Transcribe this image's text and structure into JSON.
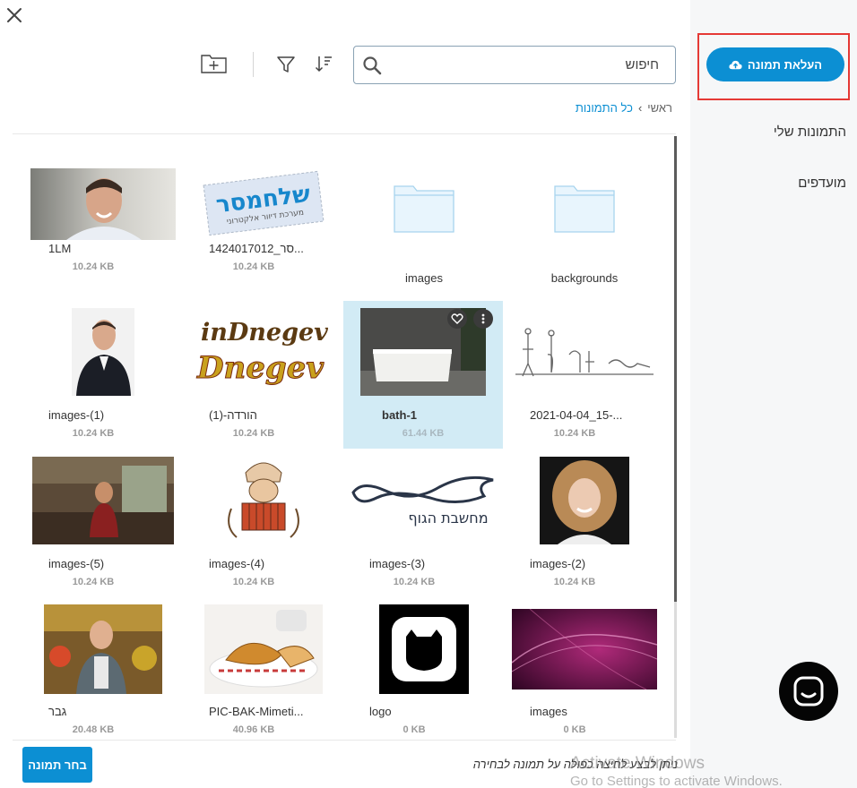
{
  "sidebar": {
    "upload_label": "העלאת תמונה",
    "items": [
      {
        "label": "התמונות שלי"
      },
      {
        "label": "מועדפים"
      }
    ]
  },
  "toolbar": {
    "search_placeholder": "חיפוש"
  },
  "breadcrumb": {
    "root": "ראשי",
    "separator": "›",
    "current": "כל התמונות"
  },
  "files": [
    {
      "name": "1LM",
      "size": "10.24 KB",
      "kind": "image",
      "icon": "portrait-man-smiling"
    },
    {
      "name": "1424017012_סר...",
      "size": "10.24 KB",
      "kind": "image",
      "icon": "shelachmeser-logo"
    },
    {
      "name": "images",
      "kind": "folder",
      "icon": "folder-icon"
    },
    {
      "name": "backgrounds",
      "kind": "folder",
      "icon": "folder-icon"
    },
    {
      "name": "images-(1)",
      "size": "10.24 KB",
      "kind": "image",
      "icon": "portrait-man-suit"
    },
    {
      "name": "הורדה-(1)",
      "size": "10.24 KB",
      "kind": "image",
      "icon": "indnegev-logo"
    },
    {
      "name": "bath-1",
      "size": "61.44 KB",
      "kind": "image",
      "selected": true,
      "icon": "bathtub-photo"
    },
    {
      "name": "2021-04-04_15-...",
      "size": "10.24 KB",
      "kind": "image",
      "icon": "sketch-figures"
    },
    {
      "name": "images-(5)",
      "size": "10.24 KB",
      "kind": "image",
      "icon": "kitchen-photo"
    },
    {
      "name": "images-(4)",
      "size": "10.24 KB",
      "kind": "image",
      "icon": "accordion-illustration"
    },
    {
      "name": "images-(3)",
      "size": "10.24 KB",
      "kind": "image",
      "icon": "body-thinking-logo"
    },
    {
      "name": "images-(2)",
      "size": "10.24 KB",
      "kind": "image",
      "icon": "portrait-woman-curly"
    },
    {
      "name": "גבר",
      "size": "20.48 KB",
      "kind": "image",
      "icon": "man-phone-market"
    },
    {
      "name": "PIC-BAK-Mimeti...",
      "size": "40.96 KB",
      "kind": "image",
      "icon": "croissant-photo"
    },
    {
      "name": "logo",
      "size": "0 KB",
      "kind": "image",
      "icon": "cat-logo"
    },
    {
      "name": "images",
      "size": "0 KB",
      "kind": "image",
      "icon": "pink-abstract"
    }
  ],
  "breadcrumb_logo": {
    "shelach_text": "שלחמסר",
    "shelach_sub": "מערכת דיוור אלקטרוני",
    "indnegev_top": "inDnegev",
    "indnegev_bottom": "Dnegev",
    "body_logo_text": "מחשבת הגוף"
  },
  "footer": {
    "choose_label": "בחר תמונה",
    "hint": "ניתן לבצע לחיצה כפולה על תמונה לבחירה"
  },
  "watermark": {
    "line1": "Activate Windows",
    "line2": "Go to Settings to activate Windows."
  },
  "colors": {
    "accent": "#0c8fd3",
    "selected_bg": "#d2ebf5",
    "highlight_border": "#e53935"
  }
}
